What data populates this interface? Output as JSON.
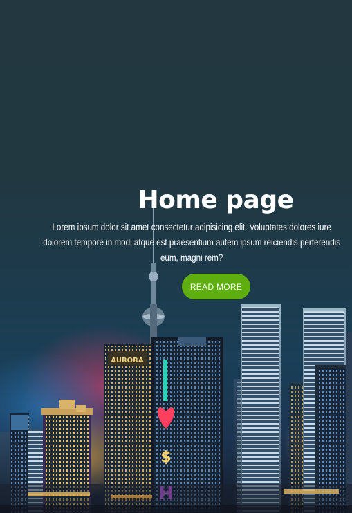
{
  "hero": {
    "title": "Home page",
    "description": "Lorem ipsum dolor sit amet consectetur adipisicing elit. Voluptates dolores iure dolorem tempore in modi atque est praesentium autem ipsum reiciendis perferendis eum, magni rem?",
    "button_label": "READ MORE",
    "accent_color": "#5fae10"
  },
  "background": {
    "image": "night-city-skyline",
    "sign_text": "AURORA"
  }
}
